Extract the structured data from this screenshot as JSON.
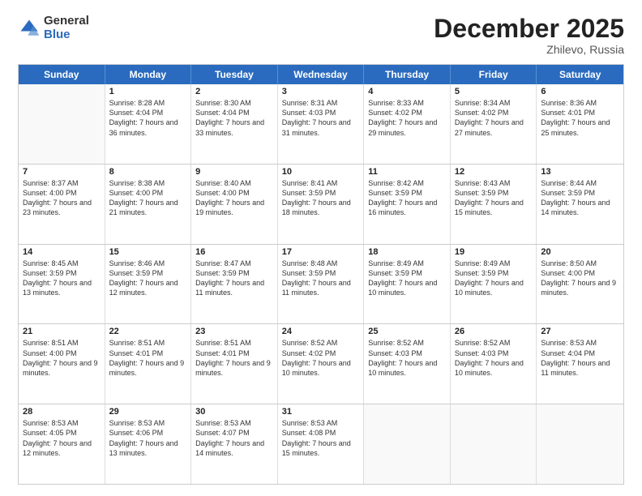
{
  "header": {
    "logo_general": "General",
    "logo_blue": "Blue",
    "month_title": "December 2025",
    "location": "Zhilevo, Russia"
  },
  "days_of_week": [
    "Sunday",
    "Monday",
    "Tuesday",
    "Wednesday",
    "Thursday",
    "Friday",
    "Saturday"
  ],
  "rows": [
    [
      {
        "day": "",
        "empty": true
      },
      {
        "day": "1",
        "sunrise": "Sunrise: 8:28 AM",
        "sunset": "Sunset: 4:04 PM",
        "daylight": "Daylight: 7 hours and 36 minutes."
      },
      {
        "day": "2",
        "sunrise": "Sunrise: 8:30 AM",
        "sunset": "Sunset: 4:04 PM",
        "daylight": "Daylight: 7 hours and 33 minutes."
      },
      {
        "day": "3",
        "sunrise": "Sunrise: 8:31 AM",
        "sunset": "Sunset: 4:03 PM",
        "daylight": "Daylight: 7 hours and 31 minutes."
      },
      {
        "day": "4",
        "sunrise": "Sunrise: 8:33 AM",
        "sunset": "Sunset: 4:02 PM",
        "daylight": "Daylight: 7 hours and 29 minutes."
      },
      {
        "day": "5",
        "sunrise": "Sunrise: 8:34 AM",
        "sunset": "Sunset: 4:02 PM",
        "daylight": "Daylight: 7 hours and 27 minutes."
      },
      {
        "day": "6",
        "sunrise": "Sunrise: 8:36 AM",
        "sunset": "Sunset: 4:01 PM",
        "daylight": "Daylight: 7 hours and 25 minutes."
      }
    ],
    [
      {
        "day": "7",
        "sunrise": "Sunrise: 8:37 AM",
        "sunset": "Sunset: 4:00 PM",
        "daylight": "Daylight: 7 hours and 23 minutes."
      },
      {
        "day": "8",
        "sunrise": "Sunrise: 8:38 AM",
        "sunset": "Sunset: 4:00 PM",
        "daylight": "Daylight: 7 hours and 21 minutes."
      },
      {
        "day": "9",
        "sunrise": "Sunrise: 8:40 AM",
        "sunset": "Sunset: 4:00 PM",
        "daylight": "Daylight: 7 hours and 19 minutes."
      },
      {
        "day": "10",
        "sunrise": "Sunrise: 8:41 AM",
        "sunset": "Sunset: 3:59 PM",
        "daylight": "Daylight: 7 hours and 18 minutes."
      },
      {
        "day": "11",
        "sunrise": "Sunrise: 8:42 AM",
        "sunset": "Sunset: 3:59 PM",
        "daylight": "Daylight: 7 hours and 16 minutes."
      },
      {
        "day": "12",
        "sunrise": "Sunrise: 8:43 AM",
        "sunset": "Sunset: 3:59 PM",
        "daylight": "Daylight: 7 hours and 15 minutes."
      },
      {
        "day": "13",
        "sunrise": "Sunrise: 8:44 AM",
        "sunset": "Sunset: 3:59 PM",
        "daylight": "Daylight: 7 hours and 14 minutes."
      }
    ],
    [
      {
        "day": "14",
        "sunrise": "Sunrise: 8:45 AM",
        "sunset": "Sunset: 3:59 PM",
        "daylight": "Daylight: 7 hours and 13 minutes."
      },
      {
        "day": "15",
        "sunrise": "Sunrise: 8:46 AM",
        "sunset": "Sunset: 3:59 PM",
        "daylight": "Daylight: 7 hours and 12 minutes."
      },
      {
        "day": "16",
        "sunrise": "Sunrise: 8:47 AM",
        "sunset": "Sunset: 3:59 PM",
        "daylight": "Daylight: 7 hours and 11 minutes."
      },
      {
        "day": "17",
        "sunrise": "Sunrise: 8:48 AM",
        "sunset": "Sunset: 3:59 PM",
        "daylight": "Daylight: 7 hours and 11 minutes."
      },
      {
        "day": "18",
        "sunrise": "Sunrise: 8:49 AM",
        "sunset": "Sunset: 3:59 PM",
        "daylight": "Daylight: 7 hours and 10 minutes."
      },
      {
        "day": "19",
        "sunrise": "Sunrise: 8:49 AM",
        "sunset": "Sunset: 3:59 PM",
        "daylight": "Daylight: 7 hours and 10 minutes."
      },
      {
        "day": "20",
        "sunrise": "Sunrise: 8:50 AM",
        "sunset": "Sunset: 4:00 PM",
        "daylight": "Daylight: 7 hours and 9 minutes."
      }
    ],
    [
      {
        "day": "21",
        "sunrise": "Sunrise: 8:51 AM",
        "sunset": "Sunset: 4:00 PM",
        "daylight": "Daylight: 7 hours and 9 minutes."
      },
      {
        "day": "22",
        "sunrise": "Sunrise: 8:51 AM",
        "sunset": "Sunset: 4:01 PM",
        "daylight": "Daylight: 7 hours and 9 minutes."
      },
      {
        "day": "23",
        "sunrise": "Sunrise: 8:51 AM",
        "sunset": "Sunset: 4:01 PM",
        "daylight": "Daylight: 7 hours and 9 minutes."
      },
      {
        "day": "24",
        "sunrise": "Sunrise: 8:52 AM",
        "sunset": "Sunset: 4:02 PM",
        "daylight": "Daylight: 7 hours and 10 minutes."
      },
      {
        "day": "25",
        "sunrise": "Sunrise: 8:52 AM",
        "sunset": "Sunset: 4:03 PM",
        "daylight": "Daylight: 7 hours and 10 minutes."
      },
      {
        "day": "26",
        "sunrise": "Sunrise: 8:52 AM",
        "sunset": "Sunset: 4:03 PM",
        "daylight": "Daylight: 7 hours and 10 minutes."
      },
      {
        "day": "27",
        "sunrise": "Sunrise: 8:53 AM",
        "sunset": "Sunset: 4:04 PM",
        "daylight": "Daylight: 7 hours and 11 minutes."
      }
    ],
    [
      {
        "day": "28",
        "sunrise": "Sunrise: 8:53 AM",
        "sunset": "Sunset: 4:05 PM",
        "daylight": "Daylight: 7 hours and 12 minutes."
      },
      {
        "day": "29",
        "sunrise": "Sunrise: 8:53 AM",
        "sunset": "Sunset: 4:06 PM",
        "daylight": "Daylight: 7 hours and 13 minutes."
      },
      {
        "day": "30",
        "sunrise": "Sunrise: 8:53 AM",
        "sunset": "Sunset: 4:07 PM",
        "daylight": "Daylight: 7 hours and 14 minutes."
      },
      {
        "day": "31",
        "sunrise": "Sunrise: 8:53 AM",
        "sunset": "Sunset: 4:08 PM",
        "daylight": "Daylight: 7 hours and 15 minutes."
      },
      {
        "day": "",
        "empty": true
      },
      {
        "day": "",
        "empty": true
      },
      {
        "day": "",
        "empty": true
      }
    ]
  ]
}
